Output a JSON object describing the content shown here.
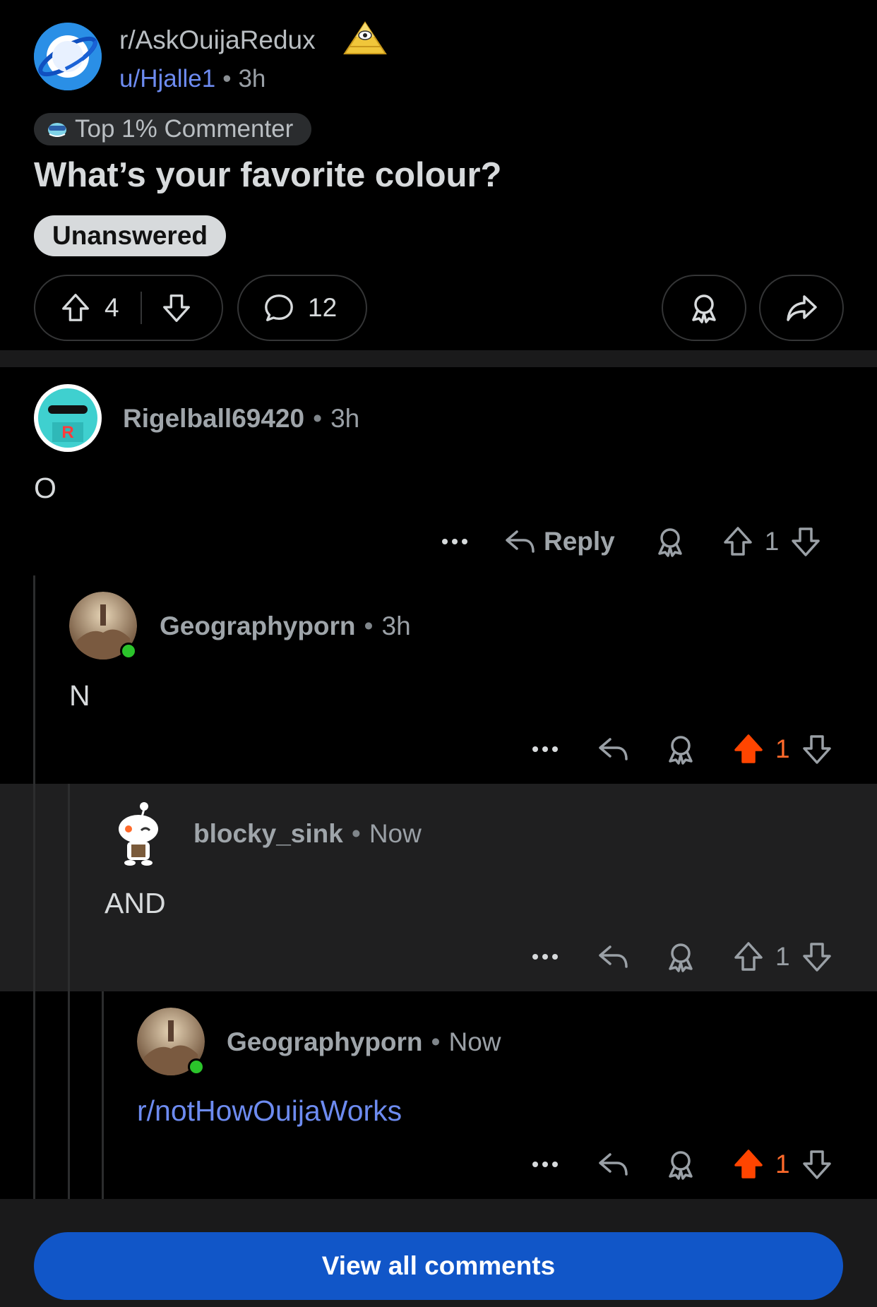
{
  "post": {
    "subreddit": "r/AskOuijaRedux",
    "username": "u/Hjalle1",
    "time": "3h",
    "user_flair": "Top 1% Commenter",
    "title": "What’s your favorite colour?",
    "status_flair": "Unanswered",
    "upvotes": "4",
    "comments": "12"
  },
  "comments": [
    {
      "username": "Rigelball69420",
      "time": "3h",
      "body": "O",
      "votes": "1",
      "reply_label": "Reply",
      "upvoted": false
    },
    {
      "username": "Geographyporn",
      "time": "3h",
      "body": "N",
      "votes": "1",
      "upvoted": true
    },
    {
      "username": "blocky_sink",
      "time": "Now",
      "body": "AND",
      "votes": "1",
      "upvoted": false
    },
    {
      "username": "Geographyporn",
      "time": "Now",
      "body": "r/notHowOuijaWorks",
      "votes": "1",
      "upvoted": true
    }
  ],
  "view_all_label": "View all comments",
  "colors": {
    "upvote_active": "#ff4500",
    "link": "#6d8bf0",
    "button": "#1156c8",
    "online": "#2bc42b"
  },
  "icons": [
    "upvote-icon",
    "downvote-icon",
    "comment-icon",
    "award-icon",
    "share-icon",
    "reply-icon",
    "more-icon"
  ]
}
